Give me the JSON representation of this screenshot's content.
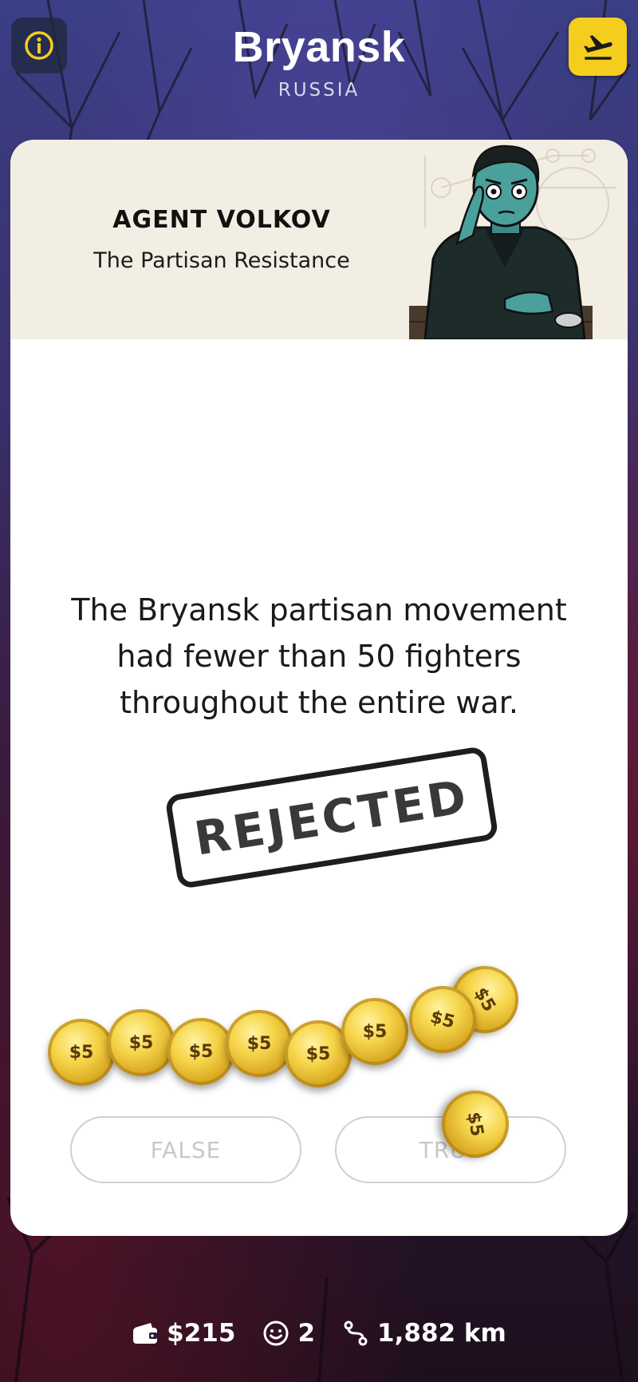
{
  "header": {
    "city": "Bryansk",
    "country": "RUSSIA"
  },
  "agent": {
    "name": "AGENT VOLKOV",
    "faction": "The Partisan Resistance"
  },
  "question": {
    "statement": "The Bryansk partisan movement had fewer than 50 fighters throughout the entire war.",
    "stamp": "REJECTED"
  },
  "answers": {
    "false_label": "FALSE",
    "true_label": "TRUE"
  },
  "coins": {
    "label": "$5",
    "count": 9
  },
  "footer": {
    "money": "$215",
    "contacts": "2",
    "distance": "1,882 km"
  },
  "colors": {
    "accent": "#f5cd1d",
    "card_header": "#f3eee3"
  },
  "icons": {
    "info": "info-icon",
    "fly": "airplane-departure-icon",
    "wallet": "wallet-icon",
    "smiley": "smiley-icon",
    "route": "route-icon"
  }
}
